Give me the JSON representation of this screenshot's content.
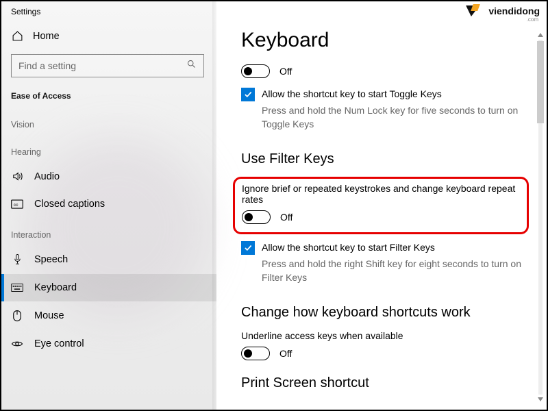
{
  "window": {
    "title": "Settings"
  },
  "watermark": {
    "text": "viendidong",
    "sub": ".com"
  },
  "sidebar": {
    "home": "Home",
    "search_placeholder": "Find a setting",
    "group": "Ease of Access",
    "categories": {
      "vision": "Vision",
      "hearing": "Hearing",
      "interaction": "Interaction"
    },
    "items": {
      "audio": "Audio",
      "closed_captions": "Closed captions",
      "speech": "Speech",
      "keyboard": "Keyboard",
      "mouse": "Mouse",
      "eye_control": "Eye control"
    }
  },
  "main": {
    "title": "Keyboard",
    "toggle1_state": "Off",
    "toggle_keys": {
      "check_label": "Allow the shortcut key to start Toggle Keys",
      "hint": "Press and hold the Num Lock key for five seconds to turn on Toggle Keys"
    },
    "filter": {
      "heading": "Use Filter Keys",
      "desc": "Ignore brief or repeated keystrokes and change keyboard repeat rates",
      "state": "Off",
      "check_label": "Allow the shortcut key to start Filter Keys",
      "hint": "Press and hold the right Shift key for eight seconds to turn on Filter Keys"
    },
    "shortcuts": {
      "heading": "Change how keyboard shortcuts work",
      "desc": "Underline access keys when available",
      "state": "Off"
    },
    "printscreen": {
      "heading": "Print Screen shortcut"
    }
  }
}
